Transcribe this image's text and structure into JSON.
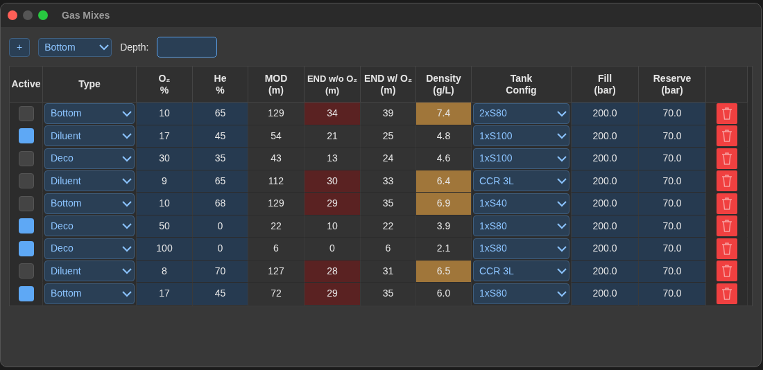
{
  "window": {
    "title": "Gas Mixes"
  },
  "toolbar": {
    "add_button": "+",
    "type_select": "Bottom",
    "depth_label": "Depth:"
  },
  "table": {
    "columns": [
      "Active",
      "Type",
      "O₂\n%",
      "He\n%",
      "MOD\n(m)",
      "END w/o O₂\n(m)",
      "END w/ O₂\n(m)",
      "Density\n(g/L)",
      "Tank\nConfig",
      "Fill\n(bar)",
      "Reserve\n(bar)"
    ],
    "rows": [
      {
        "active": false,
        "type": "Bottom",
        "o2": "10",
        "he": "65",
        "mod": "129",
        "end_wo_o2": "34",
        "end_wo_o2_warning": true,
        "end_w_o2": "39",
        "density": "7.4",
        "density_warning": true,
        "tank": "2xS80",
        "fill": "200.0",
        "reserve": "70.0"
      },
      {
        "active": true,
        "type": "Diluent",
        "o2": "17",
        "he": "45",
        "mod": "54",
        "end_wo_o2": "21",
        "end_wo_o2_warning": false,
        "end_w_o2": "25",
        "density": "4.8",
        "density_warning": false,
        "tank": "1xS100",
        "fill": "200.0",
        "reserve": "70.0"
      },
      {
        "active": false,
        "type": "Deco",
        "o2": "30",
        "he": "35",
        "mod": "43",
        "end_wo_o2": "13",
        "end_wo_o2_warning": false,
        "end_w_o2": "24",
        "density": "4.6",
        "density_warning": false,
        "tank": "1xS100",
        "fill": "200.0",
        "reserve": "70.0"
      },
      {
        "active": false,
        "type": "Diluent",
        "o2": "9",
        "he": "65",
        "mod": "112",
        "end_wo_o2": "30",
        "end_wo_o2_warning": true,
        "end_w_o2": "33",
        "density": "6.4",
        "density_warning": true,
        "tank": "CCR 3L",
        "fill": "200.0",
        "reserve": "70.0"
      },
      {
        "active": false,
        "type": "Bottom",
        "o2": "10",
        "he": "68",
        "mod": "129",
        "end_wo_o2": "29",
        "end_wo_o2_warning": true,
        "end_w_o2": "35",
        "density": "6.9",
        "density_warning": true,
        "tank": "1xS40",
        "fill": "200.0",
        "reserve": "70.0"
      },
      {
        "active": true,
        "type": "Deco",
        "o2": "50",
        "he": "0",
        "mod": "22",
        "end_wo_o2": "10",
        "end_wo_o2_warning": false,
        "end_w_o2": "22",
        "density": "3.9",
        "density_warning": false,
        "tank": "1xS80",
        "fill": "200.0",
        "reserve": "70.0"
      },
      {
        "active": true,
        "type": "Deco",
        "o2": "100",
        "he": "0",
        "mod": "6",
        "end_wo_o2": "0",
        "end_wo_o2_warning": false,
        "end_w_o2": "6",
        "density": "2.1",
        "density_warning": false,
        "tank": "1xS80",
        "fill": "200.0",
        "reserve": "70.0"
      },
      {
        "active": false,
        "type": "Diluent",
        "o2": "8",
        "he": "70",
        "mod": "127",
        "end_wo_o2": "28",
        "end_wo_o2_warning": true,
        "end_w_o2": "31",
        "density": "6.5",
        "density_warning": true,
        "tank": "CCR 3L",
        "fill": "200.0",
        "reserve": "70.0"
      },
      {
        "active": true,
        "type": "Bottom",
        "o2": "17",
        "he": "45",
        "mod": "72",
        "end_wo_o2": "29",
        "end_wo_o2_warning": true,
        "end_w_o2": "35",
        "density": "6.0",
        "density_warning": false,
        "tank": "1xS80",
        "fill": "200.0",
        "reserve": "70.0"
      }
    ]
  }
}
